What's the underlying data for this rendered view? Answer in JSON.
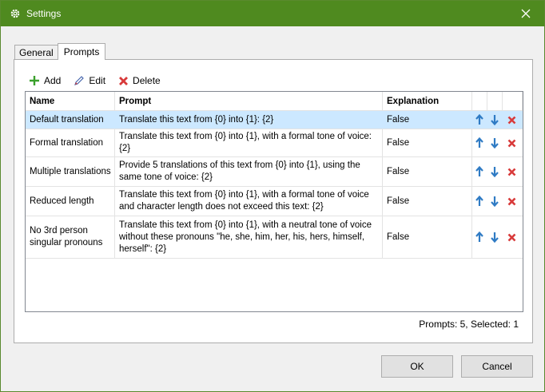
{
  "window": {
    "title": "Settings"
  },
  "tabs": [
    {
      "label": "General"
    },
    {
      "label": "Prompts"
    }
  ],
  "toolbar": {
    "add_label": "Add",
    "edit_label": "Edit",
    "delete_label": "Delete"
  },
  "grid": {
    "columns": [
      "Name",
      "Prompt",
      "Explanation"
    ],
    "rows": [
      {
        "name": "Default translation",
        "prompt": "Translate this text from {0} into {1}: {2}",
        "explanation": "False",
        "selected": true
      },
      {
        "name": "Formal translation",
        "prompt": "Translate this text from {0} into {1}, with a formal tone of voice: {2}",
        "explanation": "False",
        "selected": false
      },
      {
        "name": "Multiple translations",
        "prompt": "Provide 5 translations of this text from {0} into {1}, using the same tone of voice: {2}",
        "explanation": "False",
        "selected": false
      },
      {
        "name": "Reduced length",
        "prompt": "Translate this text from {0} into {1}, with a formal tone of voice and character length does not exceed this text: {2}",
        "explanation": "False",
        "selected": false
      },
      {
        "name": "No 3rd person singular pronouns",
        "prompt": "Translate this text from {0} into {1}, with a neutral tone of voice without these pronouns \"he, she, him, her, his, hers, himself, herself\": {2}",
        "explanation": "False",
        "selected": false
      }
    ]
  },
  "status": "Prompts: 5, Selected: 1",
  "buttons": {
    "ok": "OK",
    "cancel": "Cancel"
  },
  "colors": {
    "titlebar": "#4f8a1f",
    "add_icon": "#3aa02c",
    "delete_icon": "#d83a3a",
    "arrow_icon": "#2f7bc4",
    "selected_row": "#cce8ff"
  }
}
